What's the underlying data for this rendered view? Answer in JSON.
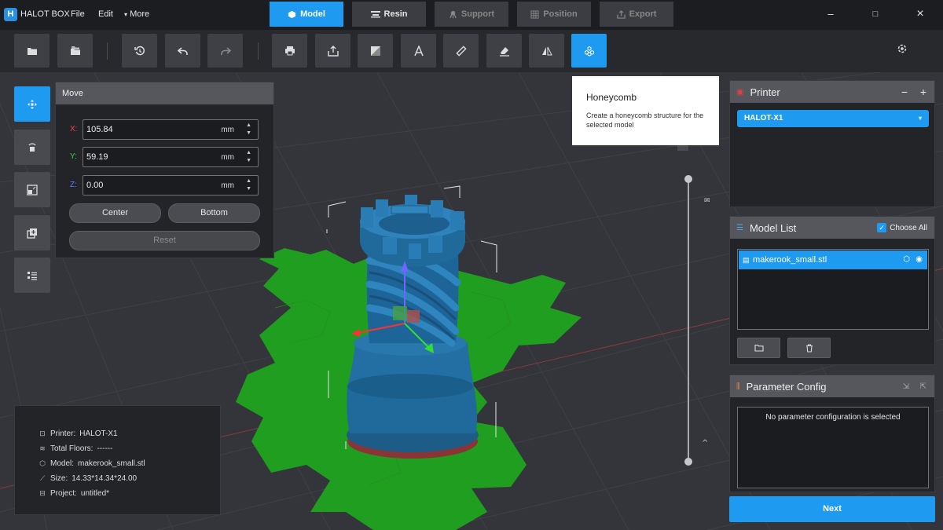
{
  "app": {
    "name": "HALOT BOX",
    "logo_letter": "H"
  },
  "menu": {
    "file": "File",
    "edit": "Edit",
    "more": "More"
  },
  "steps": [
    {
      "label": "Model",
      "state": "active"
    },
    {
      "label": "Resin",
      "state": "enabled"
    },
    {
      "label": "Support",
      "state": "disabled"
    },
    {
      "label": "Position",
      "state": "disabled"
    },
    {
      "label": "Export",
      "state": "disabled"
    }
  ],
  "window": {
    "minimize": "–",
    "maximize": "□",
    "close": "×"
  },
  "move_panel": {
    "title": "Move",
    "x": {
      "label": "X:",
      "value": "105.84",
      "unit": "mm"
    },
    "y": {
      "label": "Y:",
      "value": "59.19",
      "unit": "mm"
    },
    "z": {
      "label": "Z:",
      "value": "0.00",
      "unit": "mm"
    },
    "center": "Center",
    "bottom": "Bottom",
    "reset": "Reset"
  },
  "tooltip": {
    "title": "Honeycomb",
    "description": "Create a honeycomb structure for the selected model"
  },
  "info": {
    "printer_label": "Printer:",
    "printer_value": "HALOT-X1",
    "floors_label": "Total Floors:",
    "floors_value": "------",
    "model_label": "Model:",
    "model_value": "makerook_small.stl",
    "size_label": "Size:",
    "size_value": "14.33*14.34*24.00",
    "project_label": "Project:",
    "project_value": "untitled*"
  },
  "printer_panel": {
    "title": "Printer",
    "selected": "HALOT-X1",
    "minus": "−",
    "plus": "+"
  },
  "model_list": {
    "title": "Model List",
    "choose_all": "Choose All",
    "items": [
      "makerook_small.stl"
    ]
  },
  "param_config": {
    "title": "Parameter Config",
    "empty": "No parameter configuration is selected"
  },
  "next": "Next",
  "colors": {
    "accent": "#1e9bf0",
    "model": "#1f6a9a",
    "honeycomb": "#1f9e1f"
  }
}
